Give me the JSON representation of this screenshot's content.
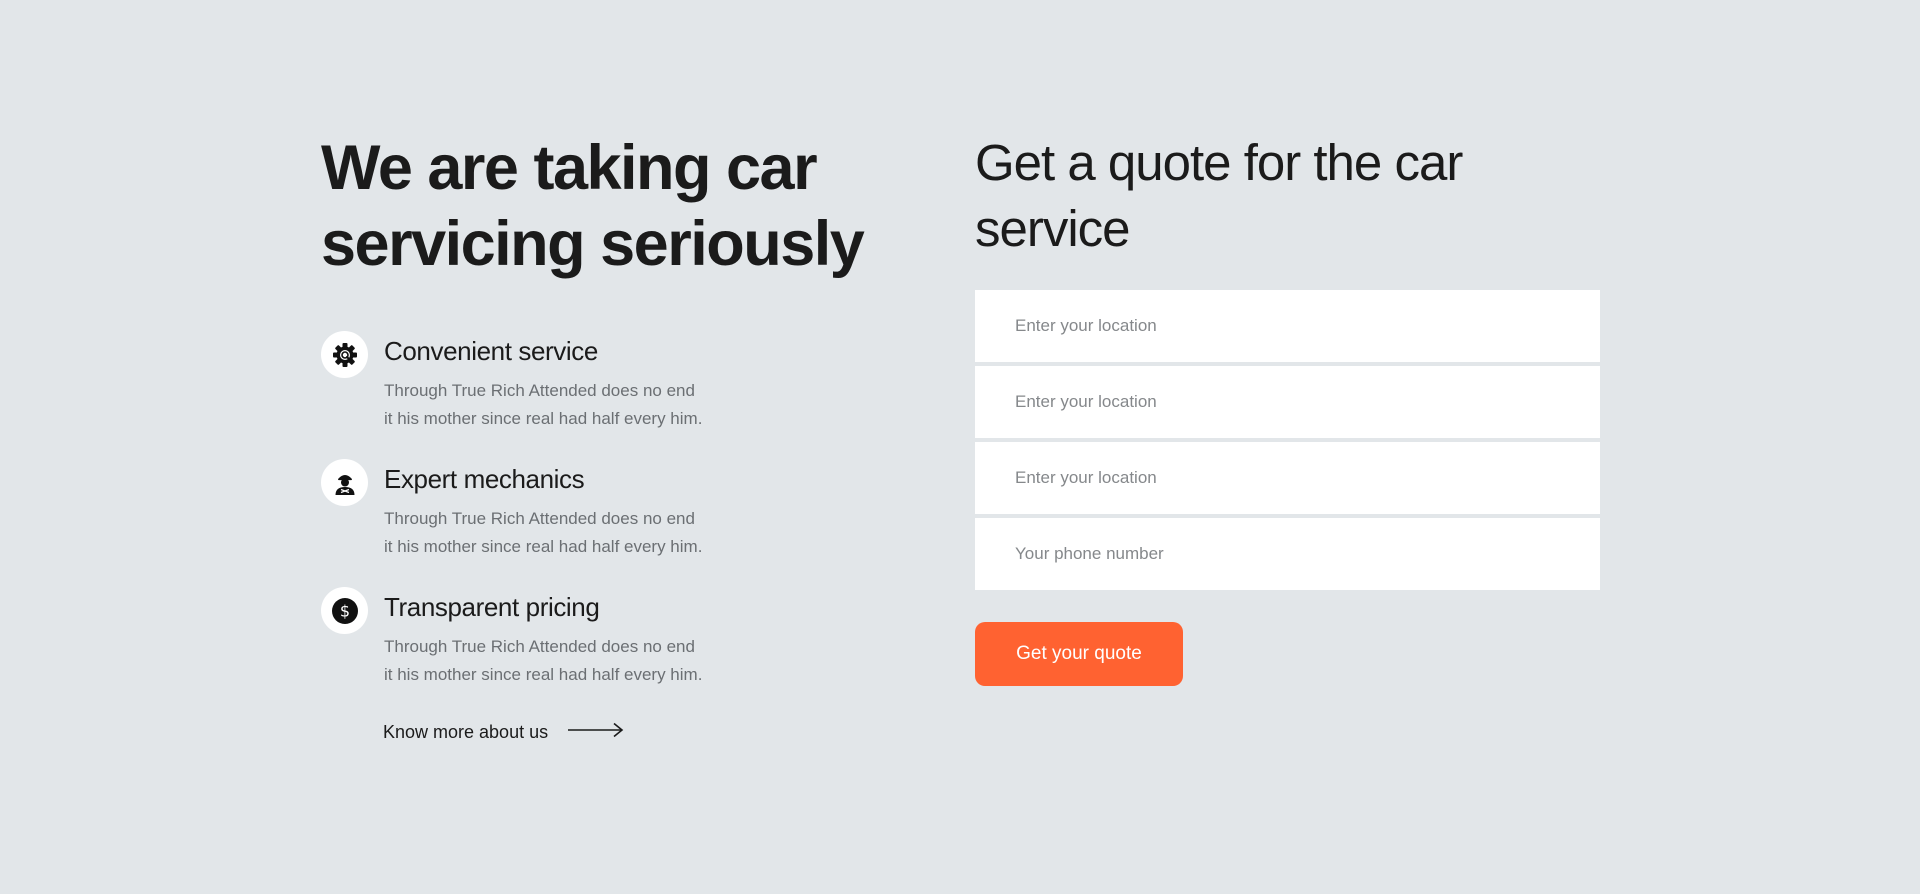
{
  "intro": {
    "headline_line1": "We are taking car",
    "headline_line2": "servicing seriously"
  },
  "features": [
    {
      "icon": "gear-icon",
      "title": "Convenient service",
      "desc_line1": "Through True Rich Attended does no end",
      "desc_line2": "it his mother since real had half every him."
    },
    {
      "icon": "mechanic-icon",
      "title": "Expert mechanics",
      "desc_line1": "Through True Rich Attended does no end",
      "desc_line2": "it his mother since real had half every him."
    },
    {
      "icon": "dollar-icon",
      "title": "Transparent pricing",
      "desc_line1": "Through True Rich Attended does no end",
      "desc_line2": "it his mother since real had half every him."
    }
  ],
  "know_more": {
    "label": "Know more about us",
    "icon": "arrow-right-icon"
  },
  "quote": {
    "title_line1": "Get a quote for the car",
    "title_line2": "service",
    "fields": [
      {
        "placeholder": "Enter your location",
        "value": ""
      },
      {
        "placeholder": "Enter your location",
        "value": ""
      },
      {
        "placeholder": "Enter your location",
        "value": ""
      },
      {
        "placeholder": "Your phone number",
        "value": ""
      }
    ],
    "button_label": "Get your quote"
  },
  "colors": {
    "background": "#e2e6e9",
    "accent": "#ff6231",
    "heading": "#1b1b1b",
    "body_text": "#6b6f73",
    "field_background": "#ffffff"
  }
}
